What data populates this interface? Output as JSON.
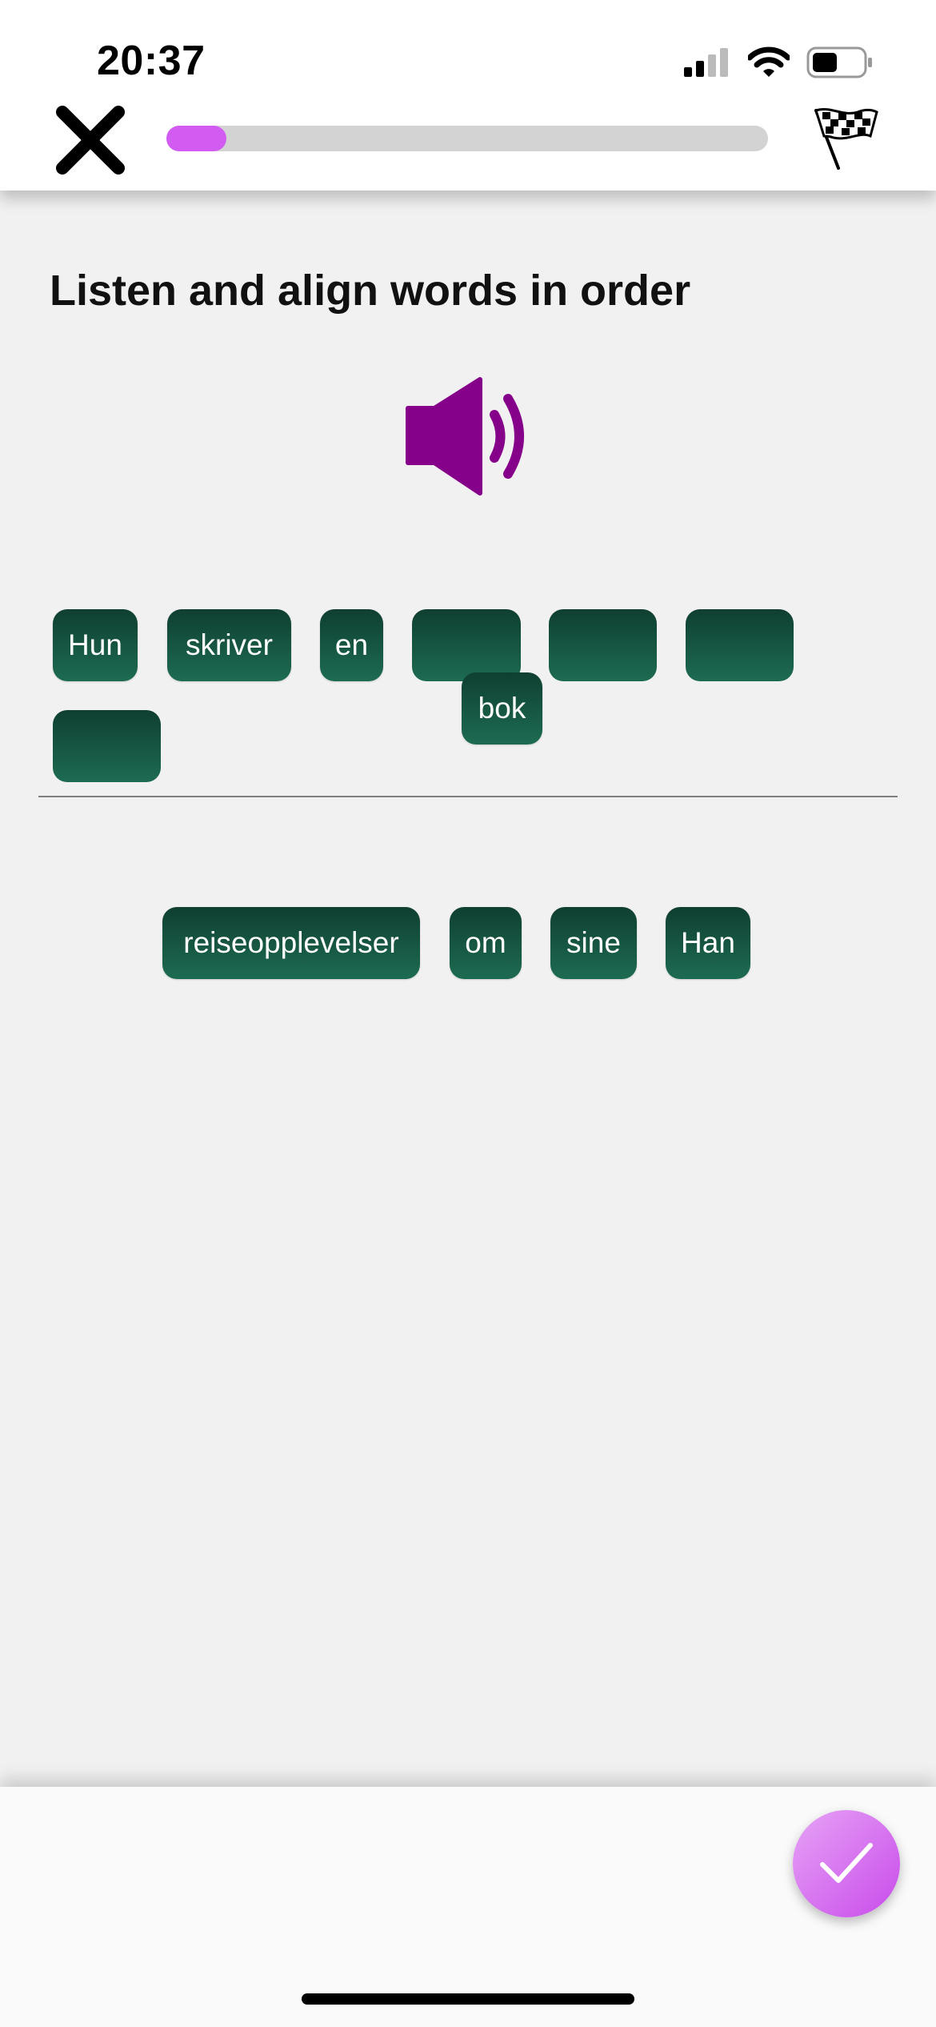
{
  "status_bar": {
    "time": "20:37",
    "icons": [
      "signal-icon",
      "wifi-icon",
      "battery-icon"
    ]
  },
  "header": {
    "close_icon": "close-icon",
    "progress": 0.1,
    "progress_color": "#d25cf1",
    "finish_icon": "checkered-flag-icon"
  },
  "exercise": {
    "instruction": "Listen and align words in order",
    "audio_icon": "speaker-icon",
    "accent_color": "#850189",
    "answer_words": [
      "Hun",
      "skriver",
      "en",
      "bok"
    ],
    "word_bank": [
      "reiseopplevelser",
      "om",
      "sine",
      "Han"
    ]
  },
  "footer": {
    "check_icon": "checkmark-icon"
  }
}
